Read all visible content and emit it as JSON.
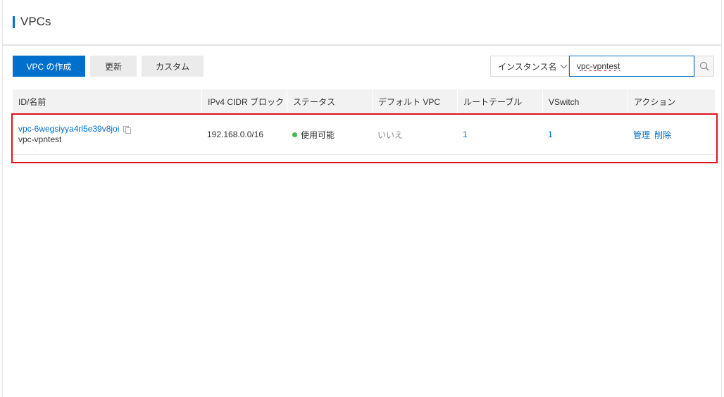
{
  "page": {
    "title": "VPCs"
  },
  "toolbar": {
    "create_label": "VPC の作成",
    "refresh_label": "更新",
    "custom_label": "カスタム"
  },
  "search": {
    "filter_label": "インスタンス名",
    "value": "vpc-vpntest"
  },
  "table": {
    "columns": [
      "ID/名前",
      "IPv4 CIDR ブロック",
      "ステータス",
      "デフォルト VPC",
      "ルートテーブル",
      "VSwitch",
      "アクション"
    ],
    "rows": [
      {
        "id": "vpc-6wegsiyya4rl5e39v8joi",
        "name": "vpc-vpntest",
        "cidr": "192.168.0.0/16",
        "status": "使用可能",
        "default_vpc": "いいえ",
        "route_tables": "1",
        "vswitches": "1",
        "action_manage": "管理",
        "action_delete": "削除"
      }
    ]
  },
  "colors": {
    "accent": "#0070cc",
    "status_available": "#3dbd4b",
    "highlight": "#e0121b"
  },
  "icons": {
    "copy": "copy-icon",
    "search": "search-icon",
    "dropdown": "chevron-down-icon",
    "status": "status-dot-icon"
  }
}
